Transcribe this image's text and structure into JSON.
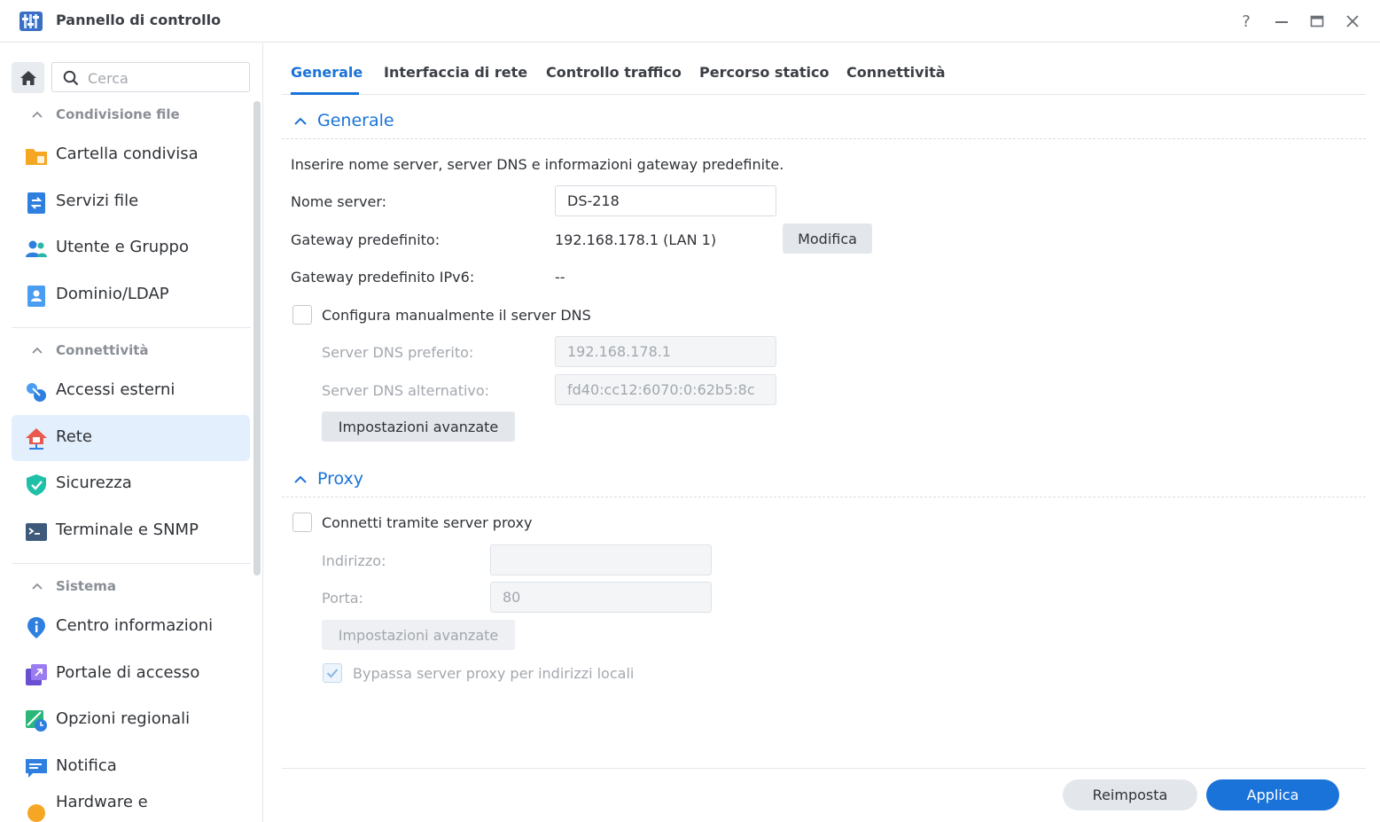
{
  "window": {
    "title": "Pannello di controllo",
    "help": "?",
    "minimize": "—",
    "close": "✕"
  },
  "sidebar": {
    "search_placeholder": "Cerca",
    "groups": [
      {
        "label": "Condivisione file",
        "items": [
          {
            "label": "Cartella condivisa",
            "icon": "shared-folder-icon"
          },
          {
            "label": "Servizi file",
            "icon": "file-services-icon"
          },
          {
            "label": "Utente e Gruppo",
            "icon": "user-group-icon"
          },
          {
            "label": "Dominio/LDAP",
            "icon": "domain-ldap-icon"
          }
        ]
      },
      {
        "label": "Connettività",
        "items": [
          {
            "label": "Accessi esterni",
            "icon": "external-access-icon"
          },
          {
            "label": "Rete",
            "icon": "network-icon",
            "active": true
          },
          {
            "label": "Sicurezza",
            "icon": "security-shield-icon"
          },
          {
            "label": "Terminale e SNMP",
            "icon": "terminal-icon"
          }
        ]
      },
      {
        "label": "Sistema",
        "items": [
          {
            "label": "Centro informazioni",
            "icon": "info-center-icon"
          },
          {
            "label": "Portale di accesso",
            "icon": "login-portal-icon"
          },
          {
            "label": "Opzioni regionali",
            "icon": "regional-options-icon"
          },
          {
            "label": "Notifica",
            "icon": "notification-icon"
          },
          {
            "label": "Hardware e",
            "icon": "hardware-icon"
          }
        ]
      }
    ]
  },
  "tabs": [
    "Generale",
    "Interfaccia di rete",
    "Controllo traffico",
    "Percorso statico",
    "Connettività"
  ],
  "general": {
    "title": "Generale",
    "description": "Inserire nome server, server DNS e informazioni gateway predefinite.",
    "server_name_label": "Nome server:",
    "server_name_value": "DS-218",
    "gateway_label": "Gateway predefinito:",
    "gateway_value": "192.168.178.1 (LAN 1)",
    "edit_button": "Modifica",
    "gateway_ipv6_label": "Gateway predefinito IPv6:",
    "gateway_ipv6_value": "--",
    "manual_dns_label": "Configura manualmente il server DNS",
    "preferred_dns_label": "Server DNS preferito:",
    "preferred_dns_value": "192.168.178.1",
    "alternate_dns_label": "Server DNS alternativo:",
    "alternate_dns_value": "fd40:cc12:6070:0:62b5:8c",
    "advanced_button": "Impostazioni avanzate"
  },
  "proxy": {
    "title": "Proxy",
    "connect_label": "Connetti tramite server proxy",
    "address_label": "Indirizzo:",
    "address_value": "",
    "port_label": "Porta:",
    "port_value": "80",
    "advanced_button": "Impostazioni avanzate",
    "bypass_label": "Bypassa server proxy per indirizzi locali"
  },
  "footer": {
    "reset": "Reimposta",
    "apply": "Applica"
  },
  "colors": {
    "accent": "#1a73d9",
    "active_item_bg": "#e3effc"
  }
}
